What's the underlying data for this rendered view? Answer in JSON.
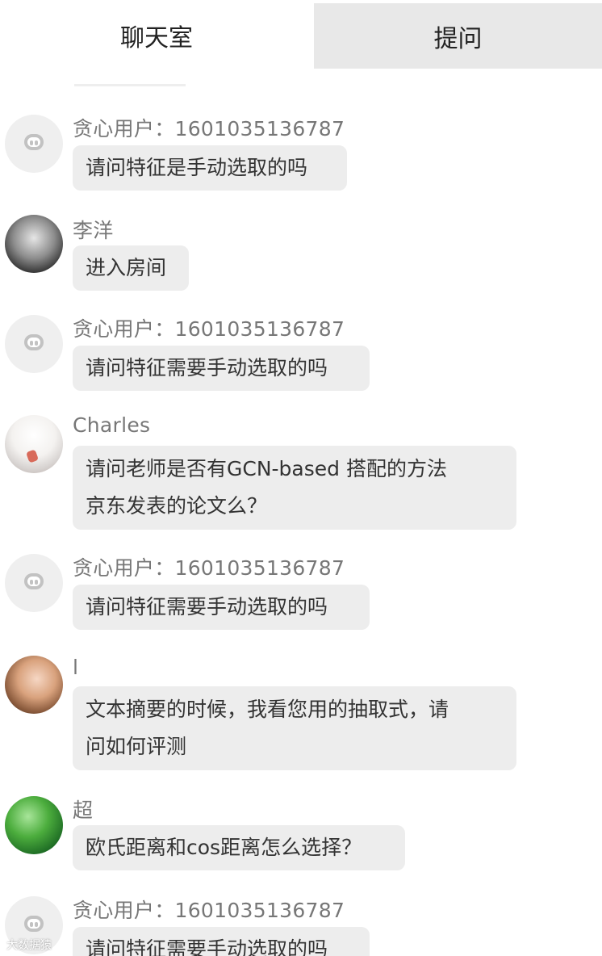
{
  "tabs": {
    "chat": "聊天室",
    "ask": "提问"
  },
  "messages": [
    {
      "name": "贪心用户：1601035136787",
      "text": "请问特征是手动选取的吗",
      "avatar": "default-avatar"
    },
    {
      "name": "李洋",
      "text": "进入房间",
      "avatar": "photo-avatar"
    },
    {
      "name": "贪心用户：1601035136787",
      "text": "请问特征需要手动选取的吗",
      "avatar": "default-avatar"
    },
    {
      "name": "Charles",
      "text_line1": "请问老师是否有GCN-based 搭配的方法",
      "text_line2": "京东发表的论文么？",
      "avatar": "anime-avatar"
    },
    {
      "name": "贪心用户：1601035136787",
      "text": "请问特征需要手动选取的吗",
      "avatar": "default-avatar"
    },
    {
      "name": "l",
      "text_line1": "文本摘要的时候，我看您用的抽取式，请",
      "text_line2": "问如何评测",
      "avatar": "cute-avatar"
    },
    {
      "name": "超",
      "text": "欧氏距离和cos距离怎么选择？",
      "avatar": "green-avatar"
    },
    {
      "name": "贪心用户：1601035136787",
      "text": "请问特征需要手动选取的吗",
      "avatar": "default-avatar"
    }
  ],
  "watermark": "大数据猿"
}
